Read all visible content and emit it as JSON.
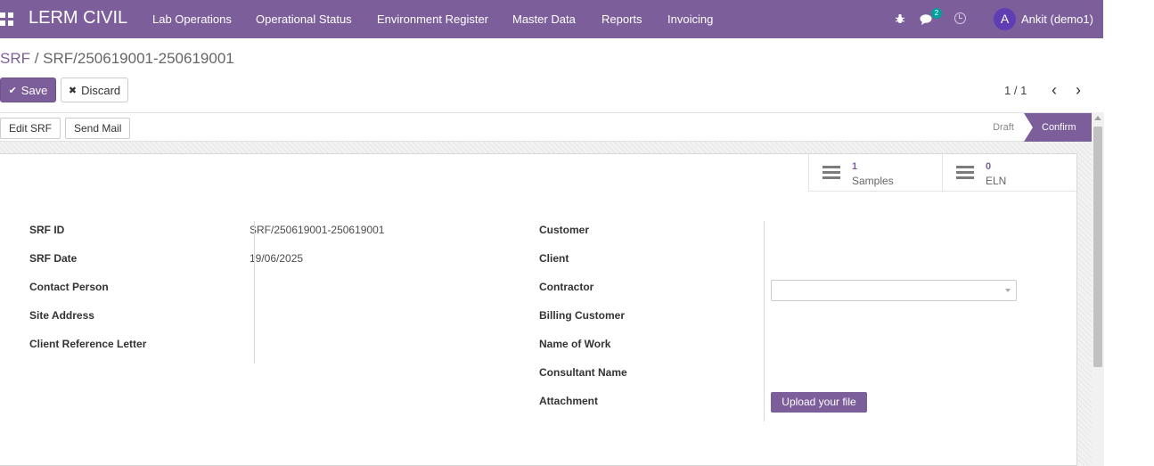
{
  "navbar": {
    "brand": "LERM CIVIL",
    "menu": [
      "Lab Operations",
      "Operational Status",
      "Environment Register",
      "Master Data",
      "Reports",
      "Invoicing"
    ],
    "chat_badge": "2",
    "avatar_letter": "A",
    "user_name": "Ankit (demo1)",
    "icons": [
      "apps-grid-icon",
      "bug-icon",
      "chat-icon",
      "clock-icon"
    ],
    "color": "#7c5e9b"
  },
  "breadcrumb": {
    "parent": "SRF",
    "separator": " / ",
    "current": "SRF/250619001-250619001"
  },
  "toolbar": {
    "save_label": "Save",
    "discard_label": "Discard"
  },
  "pager": {
    "value": "1 / 1",
    "prev": "‹",
    "next": "›"
  },
  "statusbar": {
    "buttons": [
      "Edit SRF",
      "Send Mail"
    ],
    "stages": [
      "Draft",
      "Confirm"
    ],
    "active_stage": "Confirm"
  },
  "smart_buttons": [
    {
      "value": "1",
      "label": "Samples",
      "icon": "list-icon"
    },
    {
      "value": "0",
      "label": "ELN",
      "icon": "list-icon"
    }
  ],
  "form": {
    "left": [
      {
        "label": "SRF ID",
        "value": "SRF/250619001-250619001"
      },
      {
        "label": "SRF Date",
        "value": "19/06/2025"
      },
      {
        "label": "Contact Person",
        "value": ""
      },
      {
        "label": "Site Address",
        "value": ""
      },
      {
        "label": "Client Reference Letter",
        "value": ""
      }
    ],
    "right": [
      {
        "label": "Customer"
      },
      {
        "label": "Client"
      },
      {
        "label": "Contractor",
        "value": ""
      },
      {
        "label": "Billing Customer"
      },
      {
        "label": "Name of Work"
      },
      {
        "label": "Consultant Name"
      },
      {
        "label": "Attachment"
      }
    ],
    "upload_label": "Upload your file"
  }
}
